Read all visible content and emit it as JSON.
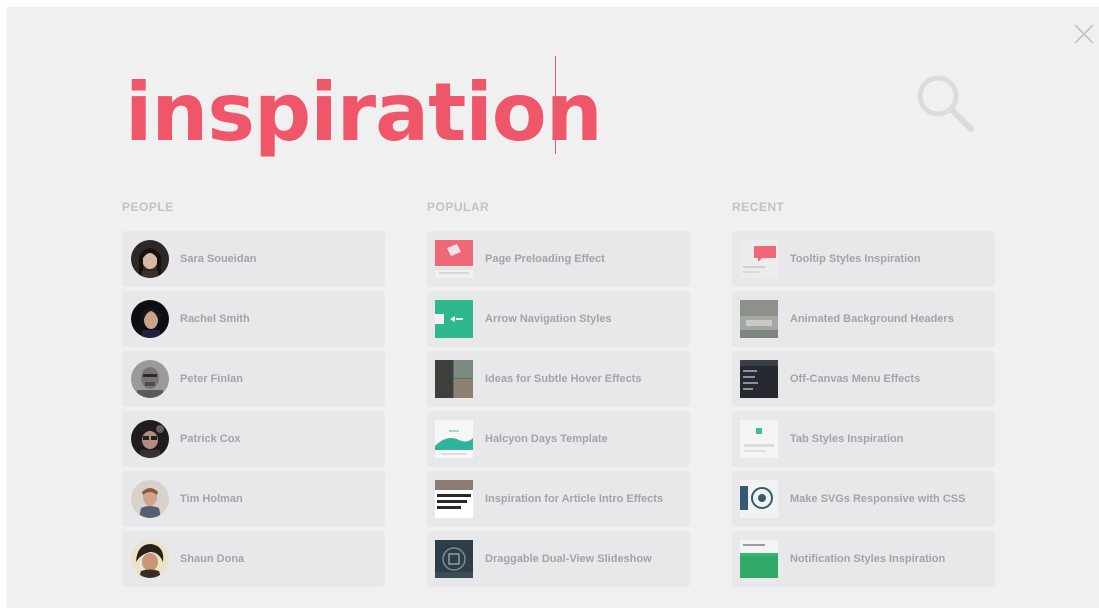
{
  "search": {
    "query": "inspiration"
  },
  "people": {
    "title": "PEOPLE",
    "items": [
      {
        "label": "Sara Soueidan"
      },
      {
        "label": "Rachel Smith"
      },
      {
        "label": "Peter Finlan"
      },
      {
        "label": "Patrick Cox"
      },
      {
        "label": "Tim Holman"
      },
      {
        "label": "Shaun Dona"
      }
    ]
  },
  "popular": {
    "title": "POPULAR",
    "items": [
      {
        "label": "Page Preloading Effect"
      },
      {
        "label": "Arrow Navigation Styles"
      },
      {
        "label": "Ideas for Subtle Hover Effects"
      },
      {
        "label": "Halcyon Days Template"
      },
      {
        "label": "Inspiration for Article Intro Effects"
      },
      {
        "label": "Draggable Dual-View Slideshow"
      }
    ]
  },
  "recent": {
    "title": "RECENT",
    "items": [
      {
        "label": "Tooltip Styles Inspiration"
      },
      {
        "label": "Animated Background Headers"
      },
      {
        "label": "Off-Canvas Menu Effects"
      },
      {
        "label": "Tab Styles Inspiration"
      },
      {
        "label": "Make SVGs Responsive with CSS"
      },
      {
        "label": "Notification Styles Inspiration"
      }
    ]
  },
  "colors": {
    "accent": "#f0566a",
    "background": "#f0f0f1",
    "item_background": "#e8e8ea",
    "label_text": "#a3a3a8",
    "heading_text": "#c3c3c6"
  },
  "icons": {
    "close": "close-icon",
    "search": "search-icon"
  }
}
